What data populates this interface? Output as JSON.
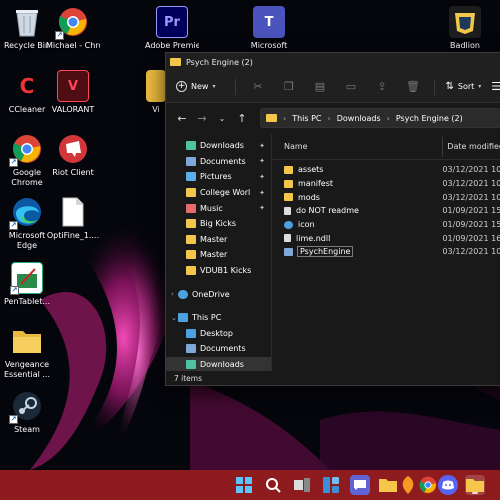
{
  "desktop": {
    "icons": [
      {
        "label": "Recycle Bin",
        "icon": "recycle-bin-icon"
      },
      {
        "label": "Michael - Chrome",
        "icon": "chrome-icon"
      },
      {
        "label": "Adobe Premiere P...",
        "icon": "premiere-icon",
        "glyph": "Pr"
      },
      {
        "label": "Microsoft",
        "icon": "teams-icon",
        "glyph": "T"
      },
      {
        "label": "Badlion",
        "icon": "badlion-icon"
      },
      {
        "label": "CCleaner",
        "icon": "ccleaner-icon",
        "glyph": "C"
      },
      {
        "label": "VALORANT",
        "icon": "valorant-icon",
        "glyph": "V"
      },
      {
        "label": "Vi",
        "icon": "folder-icon"
      },
      {
        "label": "Google Chrome",
        "icon": "chrome-icon"
      },
      {
        "label": "Riot Client",
        "icon": "riot-client-icon"
      },
      {
        "label": "Microsoft Edge",
        "icon": "edge-icon"
      },
      {
        "label": "OptiFine_1....",
        "icon": "file-icon"
      },
      {
        "label": "PenTablet...",
        "icon": "pentablet-icon"
      },
      {
        "label": "Vengeance Essential ...",
        "icon": "folder-icon"
      },
      {
        "label": "Steam",
        "icon": "steam-icon"
      }
    ]
  },
  "explorer": {
    "title": "Psych Engine (2)",
    "toolbar": {
      "new_label": "New",
      "sort_label": "Sort",
      "icons": [
        "cut-icon",
        "copy-icon",
        "paste-icon",
        "rename-icon",
        "share-icon",
        "delete-icon"
      ]
    },
    "address": {
      "crumbs": [
        "This PC",
        "Downloads",
        "Psych Engine (2)"
      ]
    },
    "nav": {
      "quick_access": [
        {
          "label": "Downloads",
          "icon": "downloads-icon",
          "pinned": true,
          "color": "#4fc3a1"
        },
        {
          "label": "Documents",
          "icon": "documents-icon",
          "pinned": true,
          "color": "#7fa7d8"
        },
        {
          "label": "Pictures",
          "icon": "pictures-icon",
          "pinned": true,
          "color": "#5ab0e8"
        },
        {
          "label": "College Worl",
          "icon": "folder-icon",
          "pinned": true,
          "color": "#f4c64a"
        },
        {
          "label": "Music",
          "icon": "music-icon",
          "pinned": true,
          "color": "#e76b6b"
        },
        {
          "label": "Big Kicks",
          "icon": "folder-icon",
          "pinned": false,
          "color": "#f4c64a"
        },
        {
          "label": "Master",
          "icon": "folder-icon",
          "pinned": false,
          "color": "#f4c64a"
        },
        {
          "label": "Master",
          "icon": "folder-icon",
          "pinned": false,
          "color": "#f4c64a"
        },
        {
          "label": "VDUB1 Kicks",
          "icon": "folder-icon",
          "pinned": false,
          "color": "#f4c64a"
        }
      ],
      "onedrive_label": "OneDrive",
      "thispc_label": "This PC",
      "thispc_items": [
        {
          "label": "Desktop",
          "icon": "desktop-icon",
          "color": "#4aa3e0"
        },
        {
          "label": "Documents",
          "icon": "documents-icon",
          "color": "#7fa7d8"
        },
        {
          "label": "Downloads",
          "icon": "downloads-icon",
          "color": "#4fc3a1",
          "selected": true
        }
      ]
    },
    "columns": {
      "name": "Name",
      "date": "Date modified"
    },
    "files": [
      {
        "name": "assets",
        "date": "03/12/2021 10:",
        "icon": "folder-icon",
        "color": "#f4c64a"
      },
      {
        "name": "manifest",
        "date": "03/12/2021 10:",
        "icon": "folder-icon",
        "color": "#f4c64a"
      },
      {
        "name": "mods",
        "date": "03/12/2021 10:",
        "icon": "folder-icon",
        "color": "#f4c64a"
      },
      {
        "name": "do NOT readme",
        "date": "01/09/2021 15:",
        "icon": "text-file-icon",
        "color": "#dddddd"
      },
      {
        "name": "icon",
        "date": "01/09/2021 15:",
        "icon": "icon-file-icon",
        "color": "#4aa3e0"
      },
      {
        "name": "lime.ndll",
        "date": "01/09/2021 16:",
        "icon": "dll-file-icon",
        "color": "#dddddd"
      },
      {
        "name": "PsychEngine",
        "date": "03/12/2021 10:",
        "icon": "exe-file-icon",
        "color": "#7fa7d8",
        "selected": true
      }
    ],
    "status": "7 items"
  },
  "taskbar": {
    "icons": [
      "start-icon",
      "search-icon",
      "task-view-icon",
      "widgets-icon",
      "teams-chat-icon",
      "file-explorer-icon",
      "music-app-icon",
      "fl-studio-icon",
      "photos-icon",
      "chrome-icon",
      "discord-icon",
      "file-explorer-active-icon"
    ]
  }
}
